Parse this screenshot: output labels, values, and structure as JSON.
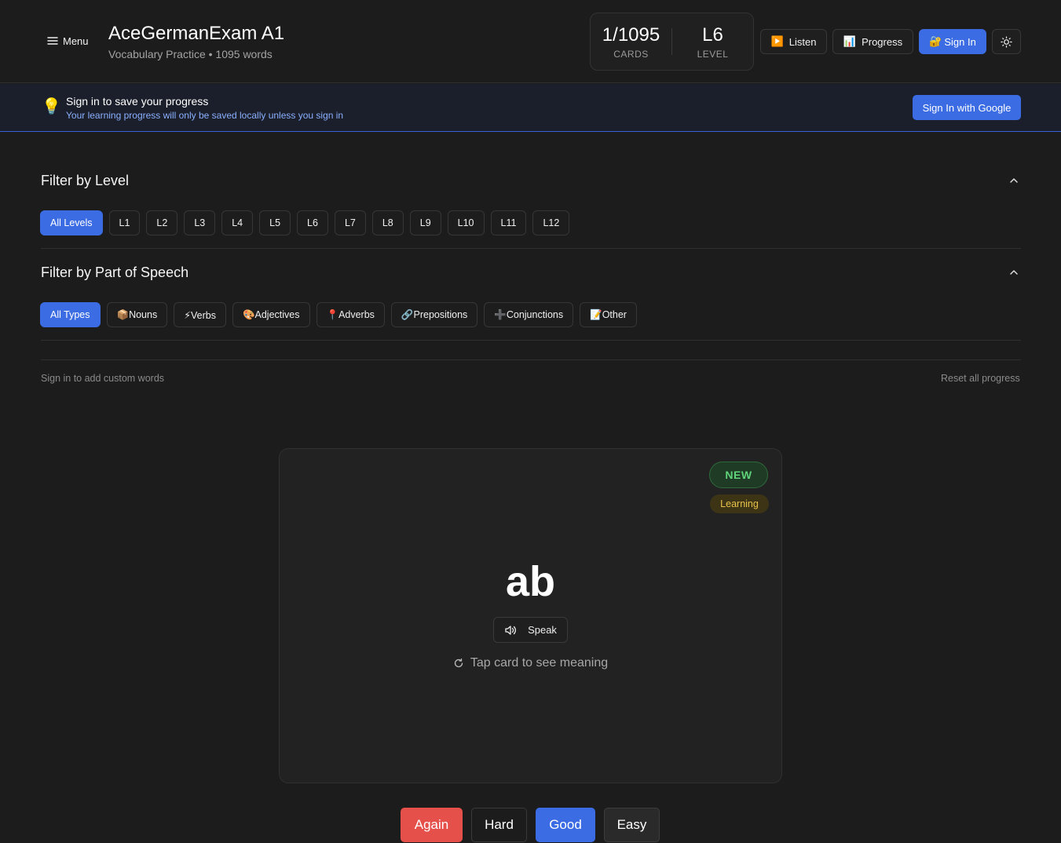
{
  "header": {
    "menu_label": "Menu",
    "title": "AceGermanExam A1",
    "subtitle": "Vocabulary Practice • 1095 words",
    "stats": {
      "cards_value": "1/1095",
      "cards_label": "CARDS",
      "level_value": "L6",
      "level_label": "LEVEL"
    },
    "buttons": {
      "listen_icon": "▶️",
      "listen": "Listen",
      "progress_icon": "📊",
      "progress": "Progress",
      "signin_icon": "🔐",
      "signin": "Sign In"
    }
  },
  "banner": {
    "icon": "💡",
    "title": "Sign in to save your progress",
    "text": "Your learning progress will only be saved locally unless you sign in",
    "button": "Sign In with Google"
  },
  "level_filter": {
    "title": "Filter by Level",
    "options": [
      "All Levels",
      "L1",
      "L2",
      "L3",
      "L4",
      "L5",
      "L6",
      "L7",
      "L8",
      "L9",
      "L10",
      "L11",
      "L12"
    ],
    "selected": "All Levels"
  },
  "pos_filter": {
    "title": "Filter by Part of Speech",
    "options": [
      "All Types",
      "📦Nouns",
      "⚡Verbs",
      "🎨Adjectives",
      "📍Adverbs",
      "🔗Prepositions",
      "➕Conjunctions",
      "📝Other"
    ],
    "selected": "All Types"
  },
  "actions": {
    "add_custom": "Sign in to add custom words",
    "reset": "Reset all progress"
  },
  "card": {
    "badge_new": "NEW",
    "badge_status": "Learning",
    "word": "ab",
    "speak": "Speak",
    "hint": "Tap card to see meaning"
  },
  "rating": {
    "again": "Again",
    "hard": "Hard",
    "good": "Good",
    "easy": "Easy"
  },
  "colors": {
    "accent": "#3b6ce4",
    "again": "#e5504a",
    "new_badge": "#5fd37a",
    "learning_badge": "#e9c24a",
    "background": "#1c1c1c"
  }
}
